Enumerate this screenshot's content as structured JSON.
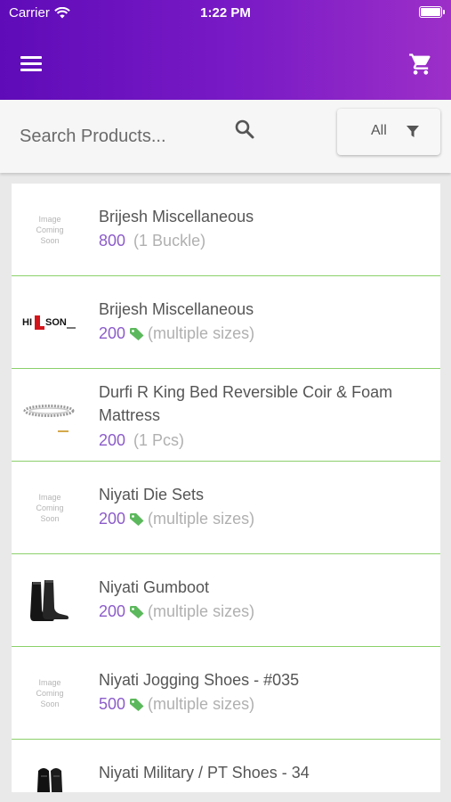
{
  "status_bar": {
    "carrier": "Carrier",
    "time": "1:22 PM"
  },
  "search": {
    "placeholder": "Search Products..."
  },
  "filter": {
    "label": "All"
  },
  "colors": {
    "header_start": "#5f0bb8",
    "header_end": "#9d2fc8",
    "price": "#8c5cc9",
    "divider": "#8bd06a",
    "tag": "#5cb85c"
  },
  "placeholder_image_text": "Image Coming Soon",
  "products": [
    {
      "name": "Brijesh Miscellaneous",
      "price": "800",
      "unit": "(1 Buckle)",
      "sizes": "",
      "thumb": "placeholder"
    },
    {
      "name": "Brijesh Miscellaneous",
      "price": "200",
      "unit": "",
      "sizes": "(multiple sizes)",
      "thumb": "hilson-logo"
    },
    {
      "name": "Durfi R King Bed Reversible Coir & Foam Mattress",
      "price": "200",
      "unit": "(1 Pcs)",
      "sizes": "",
      "thumb": "bracelet"
    },
    {
      "name": "Niyati Die Sets",
      "price": "200",
      "unit": "",
      "sizes": "(multiple sizes)",
      "thumb": "placeholder"
    },
    {
      "name": "Niyati Gumboot",
      "price": "200",
      "unit": "",
      "sizes": "(multiple sizes)",
      "thumb": "gumboot"
    },
    {
      "name": "Niyati Jogging Shoes - #035",
      "price": "500",
      "unit": "",
      "sizes": "(multiple sizes)",
      "thumb": "placeholder"
    },
    {
      "name": "Niyati Military / PT Shoes - 34",
      "price": "",
      "unit": "",
      "sizes": "",
      "thumb": "shoes"
    }
  ]
}
